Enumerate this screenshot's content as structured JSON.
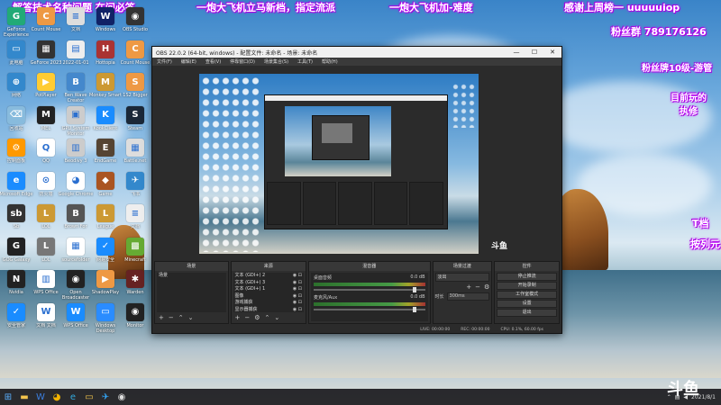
{
  "overlay_texts": [
    "解答技术名种问题 在问必答",
    "一炮大飞机立马新档，指定流派",
    "一炮大飞机加-难度",
    "感谢上周榜一 uuuuuiop",
    "粉丝群 789176126",
    "粉丝牌10级-游管",
    "目前玩的\n执修",
    "T档",
    "按列元"
  ],
  "desktop_icons": [
    {
      "label": "GeForce Experience",
      "color": "#2a7",
      "glyph": "G"
    },
    {
      "label": "Count Mouse",
      "color": "#e94",
      "glyph": "C"
    },
    {
      "label": "文档",
      "color": "#ddd",
      "glyph": "≡"
    },
    {
      "label": "Windows",
      "color": "#126",
      "glyph": "W"
    },
    {
      "label": "OBS Studio",
      "color": "#333",
      "glyph": "◉"
    },
    {
      "label": "此电脑",
      "color": "#38c",
      "glyph": "▭"
    },
    {
      "label": "GeForce 2023",
      "color": "#333",
      "glyph": "▦"
    },
    {
      "label": "2022-01-01",
      "color": "#eee",
      "glyph": "▤"
    },
    {
      "label": "Hottopia",
      "color": "#a33",
      "glyph": "H"
    },
    {
      "label": "Count Mouse",
      "color": "#e94",
      "glyph": "C"
    },
    {
      "label": "网络",
      "color": "#38c",
      "glyph": "⊕"
    },
    {
      "label": "PotPlayer",
      "color": "#fc3",
      "glyph": "▶"
    },
    {
      "label": "Ben Wave Creator",
      "color": "#48c",
      "glyph": "B"
    },
    {
      "label": "Monkey Smart",
      "color": "#c93",
      "glyph": "M"
    },
    {
      "label": "1S2 Bigger",
      "color": "#e94",
      "glyph": "S"
    },
    {
      "label": "回收站",
      "color": "#8bd",
      "glyph": "⌫"
    },
    {
      "label": "MEL",
      "color": "#222",
      "glyph": "M"
    },
    {
      "label": "GPU System Monitor",
      "color": "#ccc",
      "glyph": "▣"
    },
    {
      "label": "KookClient",
      "color": "#1a8cff",
      "glyph": "K"
    },
    {
      "label": "Steam",
      "color": "#1b2838",
      "glyph": "S"
    },
    {
      "label": "控制面板",
      "color": "#f90",
      "glyph": "⚙"
    },
    {
      "label": "QQ",
      "color": "#fff",
      "glyph": "Q"
    },
    {
      "label": "Beodivy 3",
      "color": "#ccc",
      "glyph": "▥"
    },
    {
      "label": "EndGame",
      "color": "#543",
      "glyph": "E"
    },
    {
      "label": "Battle.net",
      "color": "#ddd",
      "glyph": "▦"
    },
    {
      "label": "Microsoft Edge",
      "color": "#1a8cff",
      "glyph": "e"
    },
    {
      "label": "防火墙",
      "color": "#fff",
      "glyph": "⊙"
    },
    {
      "label": "Google Chrome",
      "color": "#fff",
      "glyph": "◕"
    },
    {
      "label": "Game",
      "color": "#a52",
      "glyph": "◆"
    },
    {
      "label": "飞书",
      "color": "#38c",
      "glyph": "✈"
    },
    {
      "label": "Sb",
      "color": "#333",
      "glyph": "sb"
    },
    {
      "label": "LOL",
      "color": "#c93",
      "glyph": "L"
    },
    {
      "label": "Brown For",
      "color": "#555",
      "glyph": "B"
    },
    {
      "label": "League",
      "color": "#c93",
      "glyph": "L"
    },
    {
      "label": "文档",
      "color": "#eee",
      "glyph": "≡"
    },
    {
      "label": "GOG Galaxy",
      "color": "#222",
      "glyph": "G"
    },
    {
      "label": "LOL",
      "color": "#777",
      "glyph": "L"
    },
    {
      "label": "sourcefolder",
      "color": "#fff",
      "glyph": "▦"
    },
    {
      "label": "网易安全",
      "color": "#1a8cff",
      "glyph": "✓"
    },
    {
      "label": "Minecraft",
      "color": "#6a3",
      "glyph": "▩"
    },
    {
      "label": "Nvidia",
      "color": "#222",
      "glyph": "N"
    },
    {
      "label": "WPS Office",
      "color": "#fff",
      "glyph": "▥"
    },
    {
      "label": "Open Broadcaster",
      "color": "#222",
      "glyph": "◉"
    },
    {
      "label": "ShadowPlay",
      "color": "#e94",
      "glyph": "▶"
    },
    {
      "label": "Warden",
      "color": "#622",
      "glyph": "✱"
    },
    {
      "label": "安全管家",
      "color": "#1a8cff",
      "glyph": "✓"
    },
    {
      "label": "文档 文档",
      "color": "#fff",
      "glyph": "W"
    },
    {
      "label": "WPS Office",
      "color": "#1a8cff",
      "glyph": "W"
    },
    {
      "label": "Windows Desktop",
      "color": "#2a8cff",
      "glyph": "▭"
    },
    {
      "label": "Monitor",
      "color": "#222",
      "glyph": "◉"
    }
  ],
  "obs": {
    "title": "OBS 22.0.2 (64-bit, windows) - 配置文件: 未命名 - 场景: 未命名",
    "menu": [
      "文件(F)",
      "编辑(E)",
      "查看(V)",
      "停靠窗口(D)",
      "场景集合(S)",
      "工具(T)",
      "帮助(H)"
    ],
    "docks": {
      "scenes": {
        "title": "场景",
        "items": [
          "场景"
        ]
      },
      "sources": {
        "title": "来源",
        "items": [
          "文本 (GDI+) 2",
          "文本 (GDI+) 3",
          "文本 (GDI+) 1",
          "图像",
          "游戏捕获",
          "显示器捕获"
        ]
      },
      "mixer": {
        "title": "混音器",
        "channels": [
          {
            "name": "桌面音频",
            "db": "0.0 dB"
          },
          {
            "name": "麦克风/Aux",
            "db": "0.0 dB"
          }
        ]
      },
      "transitions": {
        "title": "场景过渡",
        "mode": "淡出",
        "duration_label": "时长",
        "duration": "300ms"
      },
      "controls": {
        "title": "控件",
        "buttons": [
          "停止推流",
          "开始录制",
          "工作室模式",
          "设置",
          "退出"
        ]
      }
    },
    "status": {
      "live": "LIVE: 00:00:00",
      "rec": "REC: 00:00:00",
      "cpu": "CPU: 0.1%, 60.00 fps"
    }
  },
  "taskbar": {
    "date": "2021/8/1"
  },
  "watermark": "斗鱼"
}
